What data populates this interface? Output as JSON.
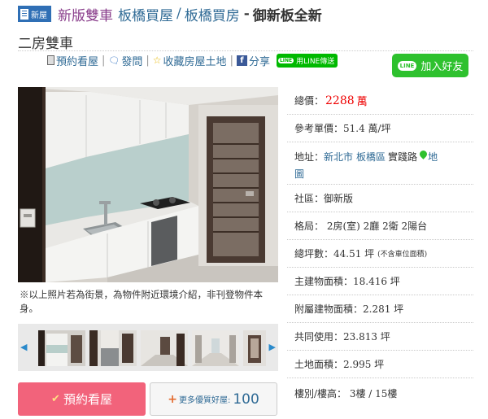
{
  "title": {
    "badge": "新屋",
    "region": "新版雙車",
    "link1": "板橋買屋",
    "separator": "/",
    "link2": "板橋買房",
    "dash": "-",
    "name_part1": "御新板全新",
    "name_part2": "二房雙車"
  },
  "actions": {
    "book_view": "預約看屋",
    "sep": "|",
    "ask": "發問",
    "favorite": "收藏房屋土地",
    "share": "分享",
    "line_share": "用LINE傳送",
    "line_badge": "LINE",
    "add_friend": "加入好友"
  },
  "gallery": {
    "caption": "※以上照片若為街景，為物件附近環境介紹，非刊登物件本身。",
    "arrow_left": "◀",
    "arrow_right": "▶"
  },
  "buttons": {
    "book": "預約看屋",
    "book_icon": "✔",
    "more_plus": "+",
    "more_label": "更多優質好屋:",
    "more_count": "100"
  },
  "specs": {
    "price_label": "總價：",
    "price_value": "2288",
    "price_unit": "萬",
    "unit_price": "參考單價：51.4 萬/坪",
    "address_label": "地址：",
    "address_city": "新北市",
    "address_district": "板橋區",
    "address_road": "實踐路",
    "map_label1": "地",
    "map_label2": "圖",
    "community": "社區：御新版",
    "layout": "格局： 2房(室) 2廳 2衛 2陽台",
    "total_area_label": "總坪數：44.51 坪",
    "total_area_note": "(不含車位面積)",
    "main_area": "主建物面積：18.416 坪",
    "attached_area": "附屬建物面積：2.281 坪",
    "common_area": "共同使用：23.813 坪",
    "land_area": "土地面積：2.995 坪",
    "floor": "樓別/樓高： 3樓 / 15樓"
  },
  "colors": {
    "title_purple": "#8a3f8c",
    "link_blue": "#2f6a95",
    "price_red": "#ee0000",
    "line_green": "#2ec12e",
    "book_button": "#f2637b",
    "badge_blue": "#2f6fb5"
  },
  "icons": {
    "book_view": "book-icon",
    "ask": "chat-bubble-icon",
    "favorite": "star-icon",
    "share": "facebook-icon",
    "map": "map-pin-icon"
  }
}
